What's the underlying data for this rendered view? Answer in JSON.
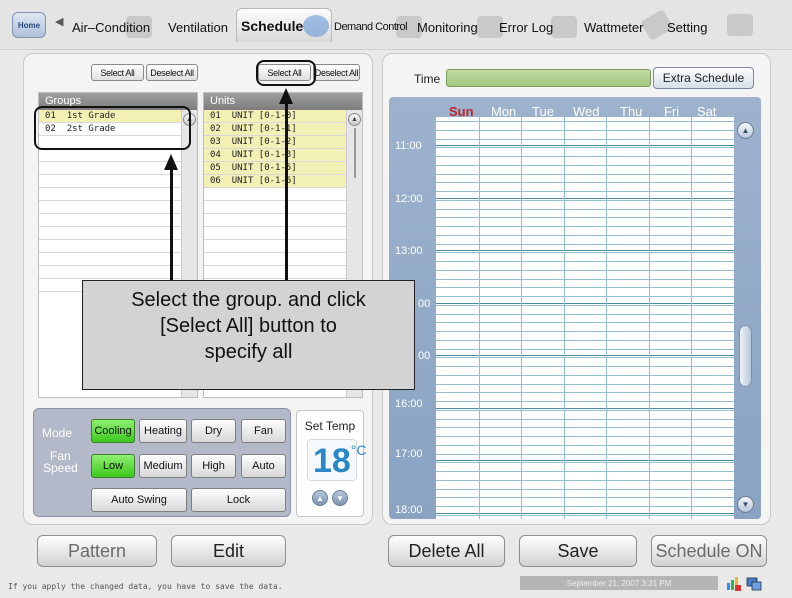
{
  "nav": {
    "home_label": "Home",
    "tabs": [
      {
        "label": "Air–Condition"
      },
      {
        "label": "Ventilation"
      },
      {
        "label": "Schedule"
      },
      {
        "label": "Demand Control"
      },
      {
        "label": "Monitoring"
      },
      {
        "label": "Error Log"
      },
      {
        "label": "Wattmeter"
      },
      {
        "label": "Setting"
      }
    ],
    "active_tab": "Schedule"
  },
  "groups": {
    "select_all": "Select All",
    "deselect_all": "Deselect All",
    "header": "Groups",
    "items": [
      {
        "num": "01",
        "name": "1st Grade"
      },
      {
        "num": "02",
        "name": "2st Grade"
      }
    ]
  },
  "units": {
    "select_all": "Select All",
    "deselect_all": "Deselect All",
    "header": "Units",
    "items": [
      {
        "num": "01",
        "name": "UNIT [0-1-0]"
      },
      {
        "num": "02",
        "name": "UNIT [0-1-1]"
      },
      {
        "num": "03",
        "name": "UNIT [0-1-2]"
      },
      {
        "num": "04",
        "name": "UNIT [0-1-3]"
      },
      {
        "num": "05",
        "name": "UNIT [0-1-5]"
      },
      {
        "num": "06",
        "name": "UNIT [0-1-6]"
      }
    ]
  },
  "callout_text": {
    "line1": "Select the group. and click",
    "line2": "[Select All] button to",
    "line3": "specify all"
  },
  "mode": {
    "mode_label": "Mode",
    "modes": [
      "Cooling",
      "Heating",
      "Dry",
      "Fan"
    ],
    "selected_mode": "Cooling",
    "fan_label_1": "Fan",
    "fan_label_2": "Speed",
    "fan_speeds": [
      "Low",
      "Medium",
      "High",
      "Auto"
    ],
    "selected_fan": "Low",
    "auto_swing": "Auto Swing",
    "lock": "Lock"
  },
  "set_temp": {
    "label": "Set Temp",
    "value": "18",
    "unit": "°C"
  },
  "schedule": {
    "time_label": "Time",
    "extra_button": "Extra Schedule",
    "days": [
      "Sun",
      "Mon",
      "Tue",
      "Wed",
      "Thu",
      "Fri",
      "Sat"
    ],
    "hours": [
      "11:00",
      "12:00",
      "13:00",
      "00",
      "00",
      "16:00",
      "17:00",
      "18:00"
    ]
  },
  "bottom": {
    "pattern": "Pattern",
    "edit": "Edit",
    "delete_all": "Delete All",
    "save": "Save",
    "schedule_on": "Schedule ON"
  },
  "footer": {
    "message": "If you apply the changed data,  you have to save the data.",
    "datetime": "September 21, 2007 3:31 PM"
  },
  "colors": {
    "active_green": "#3cc81e",
    "highlight_row": "#f2f0b5",
    "sunday_red": "#c0262a",
    "temp_blue": "#2a88c9"
  }
}
